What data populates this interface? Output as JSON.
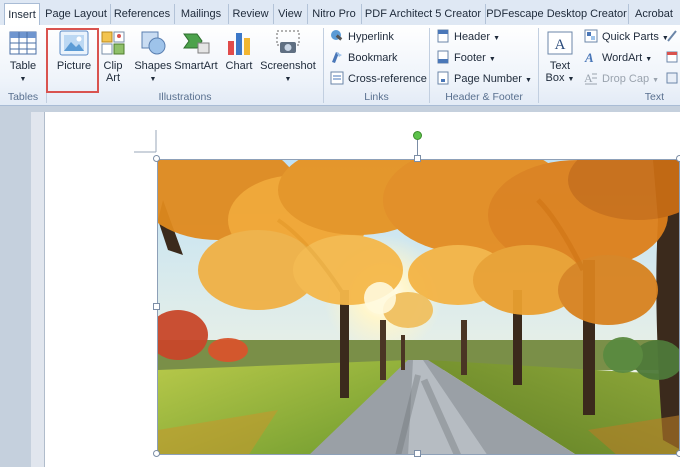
{
  "tabs": [
    {
      "label": "Insert",
      "active": true
    },
    {
      "label": "Page Layout"
    },
    {
      "label": "References"
    },
    {
      "label": "Mailings"
    },
    {
      "label": "Review"
    },
    {
      "label": "View"
    },
    {
      "label": "Nitro Pro"
    },
    {
      "label": "PDF Architect 5 Creator"
    },
    {
      "label": "PDFescape Desktop Creator"
    },
    {
      "label": "Acrobat"
    }
  ],
  "groups": {
    "tables": {
      "label": "Tables",
      "table": "Table"
    },
    "illustrations": {
      "label": "Illustrations",
      "picture": "Picture",
      "clip_art": [
        "Clip",
        "Art"
      ],
      "shapes": "Shapes",
      "smartart": "SmartArt",
      "chart": "Chart",
      "screenshot": "Screenshot"
    },
    "links": {
      "label": "Links",
      "hyperlink": "Hyperlink",
      "bookmark": "Bookmark",
      "cross_reference": "Cross-reference"
    },
    "header_footer": {
      "label": "Header & Footer",
      "header": "Header",
      "footer": "Footer",
      "page_number": "Page Number"
    },
    "text": {
      "label": "Text",
      "text_box": [
        "Text",
        "Box"
      ],
      "quick_parts": "Quick Parts",
      "wordart": "WordArt",
      "drop_cap": "Drop Cap"
    }
  },
  "colors": {
    "highlight": "#d9534f",
    "ribbon_bg": "#eef3fa",
    "tab_bar": "#dfe8f4",
    "rotate_handle": "#5cc24a"
  },
  "icons": [
    "table-icon",
    "picture-icon",
    "clip-art-icon",
    "shapes-icon",
    "smartart-icon",
    "chart-icon",
    "screenshot-icon",
    "hyperlink-icon",
    "bookmark-icon",
    "cross-reference-icon",
    "header-icon",
    "footer-icon",
    "page-number-icon",
    "text-box-icon",
    "quick-parts-icon",
    "wordart-icon",
    "drop-cap-icon"
  ]
}
